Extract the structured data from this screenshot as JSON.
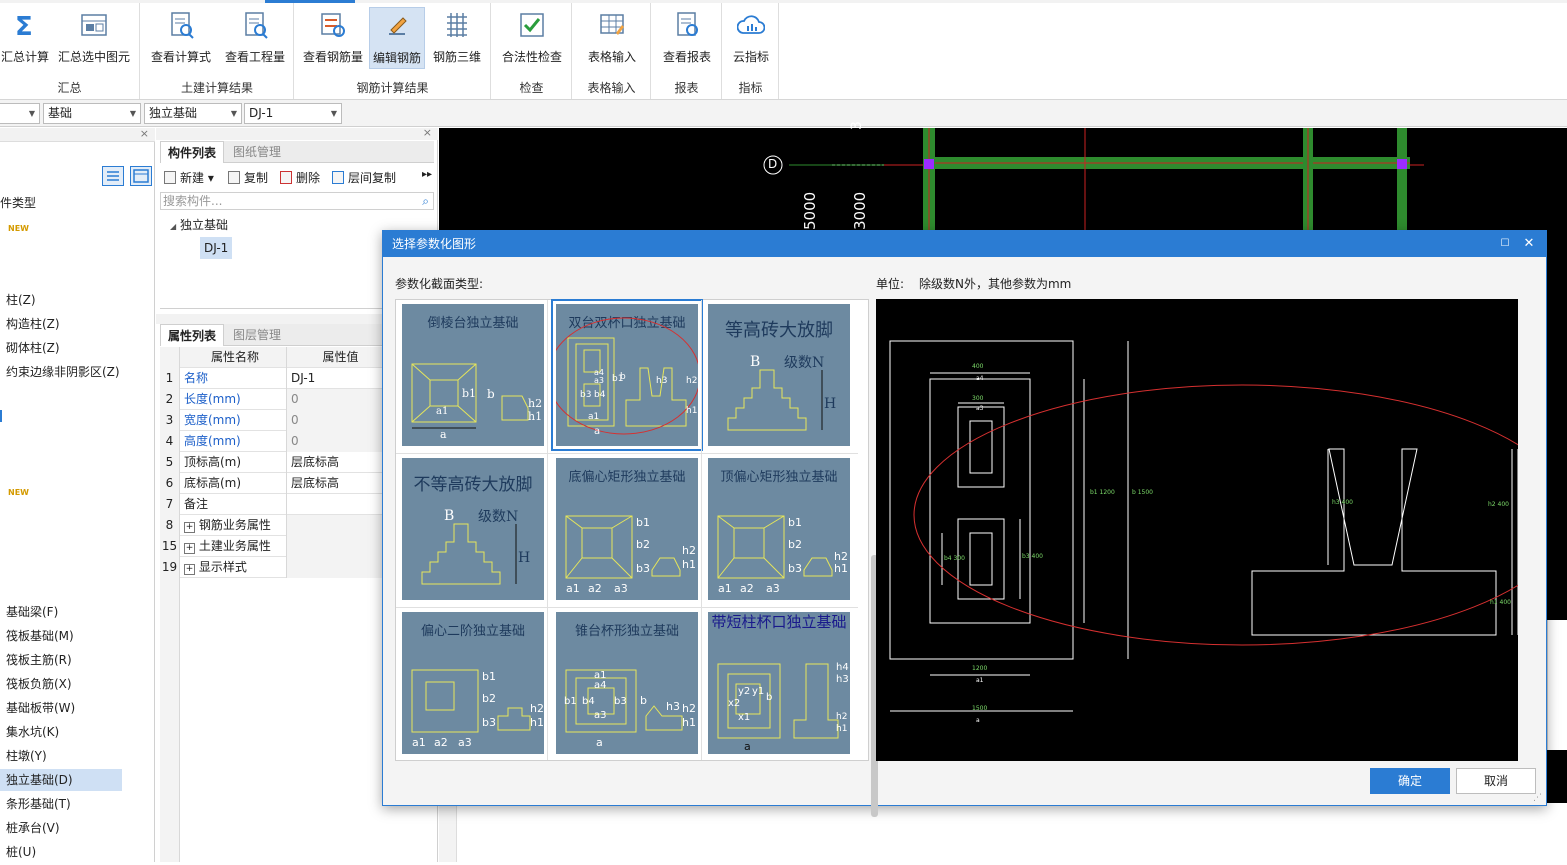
{
  "ribbon": {
    "groups": [
      {
        "label": "汇总",
        "buttons": [
          "汇总计算",
          "汇总选中图元"
        ]
      },
      {
        "label": "土建计算结果",
        "buttons": [
          "查看计算式",
          "查看工程量"
        ]
      },
      {
        "label": "钢筋计算结果",
        "buttons": [
          "查看钢筋量",
          "编辑钢筋",
          "钢筋三维"
        ]
      },
      {
        "label": "检查",
        "buttons": [
          "合法性检查"
        ]
      },
      {
        "label": "表格输入",
        "buttons": [
          "表格输入"
        ]
      },
      {
        "label": "报表",
        "buttons": [
          "查看报表"
        ]
      },
      {
        "label": "指标",
        "buttons": [
          "云指标"
        ]
      }
    ],
    "active_button": "编辑钢筋",
    "accent": "#2b7cd3"
  },
  "selectors": {
    "level": "",
    "category": "基础",
    "type": "独立基础",
    "component": "DJ-1"
  },
  "leftnav": {
    "header": "件类型",
    "new_tag": "NEW",
    "items": [
      "柱(Z)",
      "构造柱(Z)",
      "砌体柱(Z)",
      "约束边缘非阴影区(Z)"
    ],
    "items2": [
      "基础梁(F)",
      "筏板基础(M)",
      "筏板主筋(R)",
      "筏板负筋(X)",
      "基础板带(W)",
      "集水坑(K)",
      "柱墩(Y)",
      "独立基础(D)",
      "条形基础(T)",
      "桩承台(V)",
      "桩(U)"
    ],
    "selected": "独立基础(D)"
  },
  "component_list": {
    "tabs": [
      "构件列表",
      "图纸管理"
    ],
    "toolbar": {
      "new": "新建",
      "copy": "复制",
      "delete": "删除",
      "floor_copy": "层间复制"
    },
    "search_placeholder": "搜索构件...",
    "tree_parent": "独立基础",
    "tree_child": "DJ-1"
  },
  "property_list": {
    "tabs": [
      "属性列表",
      "图层管理"
    ],
    "headers": [
      "属性名称",
      "属性值"
    ],
    "rows": [
      {
        "num": "1",
        "name": "名称",
        "value": "DJ-1"
      },
      {
        "num": "2",
        "name": "长度(mm)",
        "value": "0"
      },
      {
        "num": "3",
        "name": "宽度(mm)",
        "value": "0"
      },
      {
        "num": "4",
        "name": "高度(mm)",
        "value": "0"
      },
      {
        "num": "5",
        "name": "顶标高(m)",
        "value": "层底标高"
      },
      {
        "num": "6",
        "name": "底标高(m)",
        "value": "层底标高"
      },
      {
        "num": "7",
        "name": "备注",
        "value": ""
      },
      {
        "num": "8",
        "name": "钢筋业务属性",
        "value": ""
      },
      {
        "num": "15",
        "name": "土建业务属性",
        "value": ""
      },
      {
        "num": "19",
        "name": "显示样式",
        "value": ""
      }
    ]
  },
  "cad": {
    "axis_label": "D",
    "dim_labels": [
      "3",
      "3000",
      "5000"
    ]
  },
  "dialog": {
    "title": "选择参数化图形",
    "section_label": "参数化截面类型:",
    "unit_label": "单位:",
    "unit_text": "除级数N外，其他参数为mm",
    "thumbnails": [
      {
        "title": "倒棱台独立基础",
        "labels": [
          "b1",
          "b",
          "h2",
          "h1",
          "a1",
          "a"
        ]
      },
      {
        "title": "双台双杯口独立基础",
        "labels": [
          "a4",
          "a3",
          "b3",
          "b4",
          "b1",
          "b",
          "a1",
          "a",
          "h3",
          "h2",
          "h1"
        ]
      },
      {
        "title": "等高砖大放脚",
        "labels": [
          "B",
          "级数N",
          "H"
        ]
      },
      {
        "title": "不等高砖大放脚",
        "labels": [
          "B",
          "级数N",
          "H"
        ]
      },
      {
        "title": "底偏心矩形独立基础",
        "labels": [
          "b1",
          "b2",
          "b3",
          "h2",
          "h1",
          "a1",
          "a2",
          "a3"
        ]
      },
      {
        "title": "顶偏心矩形独立基础",
        "labels": [
          "b1",
          "b2",
          "b3",
          "h2",
          "h1",
          "a1",
          "a2",
          "a3"
        ]
      },
      {
        "title": "偏心二阶独立基础",
        "labels": [
          "b1",
          "b2",
          "b3",
          "h2",
          "h1",
          "a1",
          "a2",
          "a3"
        ]
      },
      {
        "title": "锥台杯形独立基础",
        "labels": [
          "a1",
          "a4",
          "b1",
          "b4",
          "b3",
          "a3",
          "b",
          "h3",
          "h2",
          "h1",
          "a"
        ]
      },
      {
        "title": "带短柱杯口独立基础",
        "labels": [
          "x2",
          "y2",
          "y1",
          "x1",
          "b",
          "h4",
          "h3",
          "h1",
          "h2",
          "a"
        ]
      }
    ],
    "selected_thumbnail": "双台双杯口独立基础",
    "preview_dims": [
      "400",
      "a4",
      "300",
      "a3",
      "b1 1200",
      "b 1500",
      "b4 300",
      "b3 400",
      "1200",
      "a1",
      "1500",
      "a",
      "h3 400",
      "h2 400",
      "h1 400"
    ],
    "buttons": {
      "ok": "确定",
      "cancel": "取消"
    }
  }
}
